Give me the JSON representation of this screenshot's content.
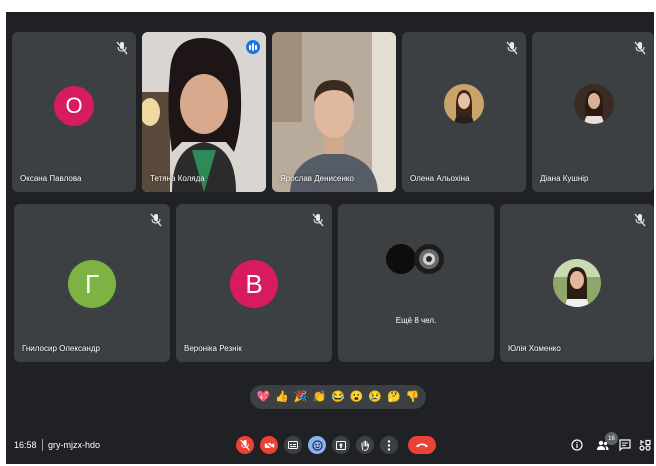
{
  "participants": [
    {
      "name": "Оксана Павлова",
      "initial": "О",
      "avatar_color": "#d81b60",
      "muted": true
    },
    {
      "name": "Тетяна Коляда",
      "speaking": true
    },
    {
      "name": "Ярослав Денисенко"
    },
    {
      "name": "Олена Альохіна",
      "muted": true
    },
    {
      "name": "Діана Кушнір",
      "muted": true
    },
    {
      "name": "Гнилосир Олександр",
      "initial": "Г",
      "avatar_color": "#7cb342",
      "muted": true
    },
    {
      "name": "Вероніка Резнік",
      "initial": "В",
      "avatar_color": "#d81b60",
      "muted": true
    },
    {
      "name": "Юлія Хоменко",
      "muted": true
    }
  ],
  "more_tile": {
    "label": "Ещё 8 чел."
  },
  "reactions": [
    "💖",
    "👍",
    "🎉",
    "👏",
    "😂",
    "😮",
    "😢",
    "🤔",
    "👎"
  ],
  "meeting_info": {
    "time": "16:58",
    "code": "gry-mjzx-hdo"
  },
  "participant_count": "16",
  "colors": {
    "background": "#202124",
    "tile": "#3c4043",
    "danger": "#ea4335",
    "accent": "#8ab4f8",
    "speaking": "#1a73e8"
  },
  "icons": {
    "controls": [
      "mic-off-icon",
      "camera-off-icon",
      "captions-icon",
      "emoji-icon",
      "present-icon",
      "raise-hand-icon",
      "more-options-icon",
      "end-call-icon"
    ],
    "right": [
      "info-icon",
      "people-icon",
      "chat-icon",
      "activities-icon"
    ]
  }
}
